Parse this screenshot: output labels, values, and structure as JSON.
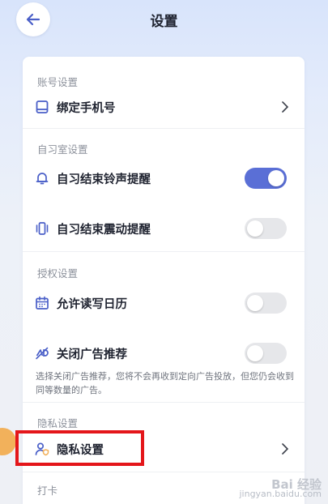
{
  "header": {
    "title": "设置"
  },
  "sections": {
    "account": {
      "title": "账号设置",
      "bind_phone": "绑定手机号"
    },
    "study_room": {
      "title": "自习室设置",
      "end_ring": "自习结束铃声提醒",
      "end_ring_on": true,
      "end_vibrate": "自习结束震动提醒",
      "end_vibrate_on": false
    },
    "auth": {
      "title": "授权设置",
      "calendar": "允许读写日历",
      "calendar_on": false,
      "close_ads": "关闭广告推荐",
      "close_ads_on": false,
      "close_ads_desc": "选择关闭广告推荐，您将不会再收到定向广告投放，但您仍会收到同等数量的广告。"
    },
    "privacy": {
      "title": "隐私设置",
      "privacy_item": "隐私设置"
    },
    "checkin": {
      "title": "打卡"
    }
  },
  "colors": {
    "accent": "#5a6fd6",
    "highlight": "#e4161a",
    "icon": "#4a5fc8"
  },
  "watermark": {
    "main": "Bai 经验",
    "sub": "jingyan.baidu.com"
  }
}
